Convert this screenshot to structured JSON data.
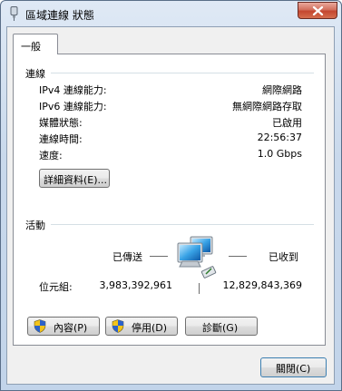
{
  "window": {
    "title": "區域連線 狀態",
    "close_icon": "close-icon"
  },
  "tabs": [
    {
      "label": "一般"
    }
  ],
  "connection": {
    "group_title": "連線",
    "rows": [
      {
        "label": "IPv4 連線能力:",
        "value": "網際網路"
      },
      {
        "label": "IPv6 連線能力:",
        "value": "無網際網路存取"
      },
      {
        "label": "媒體狀態:",
        "value": "已啟用"
      },
      {
        "label": "連線時間:",
        "value": "22:56:37"
      },
      {
        "label": "速度:",
        "value": "1.0 Gbps"
      }
    ],
    "details_button": "詳細資料(E)..."
  },
  "activity": {
    "group_title": "活動",
    "sent_label": "已傳送",
    "received_label": "已收到",
    "bytes_label": "位元組:",
    "bytes_sent": "3,983,392,961",
    "bytes_received": "12,829,843,369",
    "network_icon": "network-computers-icon"
  },
  "actions": {
    "properties_button": "內容(P)",
    "disable_button": "停用(D)",
    "diagnose_button": "診斷(G)",
    "shield_icon": "uac-shield-icon"
  },
  "footer": {
    "close_button": "關閉(C)"
  }
}
